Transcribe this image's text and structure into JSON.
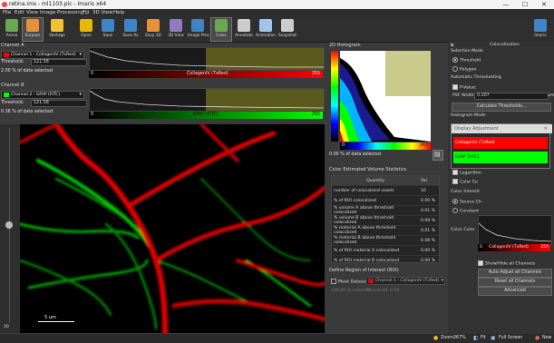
{
  "window": {
    "title": "retina.ims - ml1103.pic - Imaris x64",
    "minimize": "—",
    "maximize": "☐",
    "close": "✕"
  },
  "menu": [
    "File",
    "Edit",
    "View",
    "Image Processing",
    "Fiji",
    "3D View",
    "Help"
  ],
  "toolbar": [
    {
      "label": "Arena",
      "color": "#6aa84f"
    },
    {
      "label": "Surpass",
      "color": "#e69138"
    },
    {
      "label": "Vantage",
      "color": "#f1c232"
    },
    {
      "label": "Open",
      "color": "#e6b800"
    },
    {
      "label": "Save",
      "color": "#3d85c6"
    },
    {
      "label": "Save As",
      "color": "#3d85c6"
    },
    {
      "label": "Easy 3D",
      "color": "#e69138"
    },
    {
      "label": "3D View",
      "color": "#8e7cc3"
    },
    {
      "label": "Image Proc",
      "color": "#3d85c6"
    },
    {
      "label": "Coloc",
      "color": "#6aa84f"
    },
    {
      "label": "Annotate",
      "color": "#cccccc"
    },
    {
      "label": "Animation",
      "color": "#9fc5e8"
    },
    {
      "label": "Snapshot",
      "color": "#cccccc"
    },
    {
      "label": "Imaris",
      "color": "#3d85c6"
    }
  ],
  "channel_a": {
    "header": "Channel A",
    "selected": "Channel 1 - CollagenIV (TxRed)",
    "threshold_label": "Threshold:",
    "threshold_value": "121.58",
    "selected_pct": "2.00 % of data selected",
    "bar_min": "0",
    "bar_label": "CollagenIV (TxRed)",
    "bar_max": "255",
    "color": "#ff0000"
  },
  "channel_b": {
    "header": "Channel B",
    "selected": "Channel 2 - GFAP (FITC)",
    "threshold_label": "Threshold:",
    "threshold_value": "121.58",
    "selected_pct": "0.36 % of data selected",
    "bar_min": "0",
    "bar_label": "GFAP (FITC)",
    "bar_max": "255",
    "color": "#00ff00"
  },
  "viewer": {
    "scale_label": "5 um",
    "slider_min": "10"
  },
  "histogram_2d": {
    "title": "2D Histogram",
    "min": "0",
    "max": "243",
    "selected_pct": "0.00 % of data selected"
  },
  "stats": {
    "title": "Coloc Estimated Volume Statistics",
    "headers": [
      "Quantity",
      "Val"
    ],
    "rows": [
      [
        "number of colocalized voxels",
        "10"
      ],
      [
        "% of ROI colocalized",
        "0.00 %"
      ],
      [
        "% volume A above threshold colocalized",
        "0.01 %"
      ],
      [
        "% volume B above threshold colocalized",
        "0.09 %"
      ],
      [
        "% material A above threshold colocalized",
        "0.01 %"
      ],
      [
        "% material B above threshold colocalized",
        "0.08 %"
      ],
      [
        "% of ROI material A colocalized",
        "0.00 %"
      ],
      [
        "% of ROI material B colocalized",
        "0.00 %"
      ]
    ]
  },
  "roi": {
    "title": "Define Region of Interest (ROI)",
    "mask_label": "Mask Dataset",
    "mask_channel": "Channel 1 - CollagenIV (TxRed)",
    "mask_pct": "100.00 % selected",
    "threshold_label": "Threshold",
    "threshold_value": "0.00"
  },
  "coloc_panel": {
    "title": "Colocalization",
    "selection_mode": "Selection Mode",
    "opt_threshold": "Threshold",
    "opt_polygon": "Polygon",
    "auto_thresh": "Automatic Thresholding",
    "p_value": "P-Value:",
    "psf_width": "PSF Width:",
    "psf_value": "0.207",
    "psf_unit": "um",
    "calc_button": "Calculate Thresholds...",
    "histogram_mode": "Histogram Mode",
    "single": "Single Ti",
    "single2": "Single Ti",
    "all_time": "All Time P",
    "histogram_opts": "Histogram Op",
    "ignore": "Ignore Bi",
    "logarithm": "Logarithm",
    "color_coding": "Color Co",
    "coloc_intensity": "Coloc Intensit",
    "source_channel": "Source Ch",
    "constant": "Constant",
    "coloc_color": "Coloc Color",
    "show_hide": "Show/Hide all Channels",
    "auto_adjust": "Auto Adjust all Channels",
    "reset": "Reset all Channels",
    "advanced": "Advanced",
    "bottom_bar_min": "0",
    "bottom_bar_label": "CollagenIV (TxRed)",
    "bottom_bar_max": "255"
  },
  "display_popup": {
    "title": "Display Adjustment",
    "ch1": "CollagenIV (TxRed)",
    "ch2": "GFAP (FITC)"
  },
  "statusbar": {
    "zoom_label": "Zoom:",
    "zoom_value": "267%",
    "fit": "Fit",
    "full_screen": "Full Screen",
    "new": "New"
  }
}
